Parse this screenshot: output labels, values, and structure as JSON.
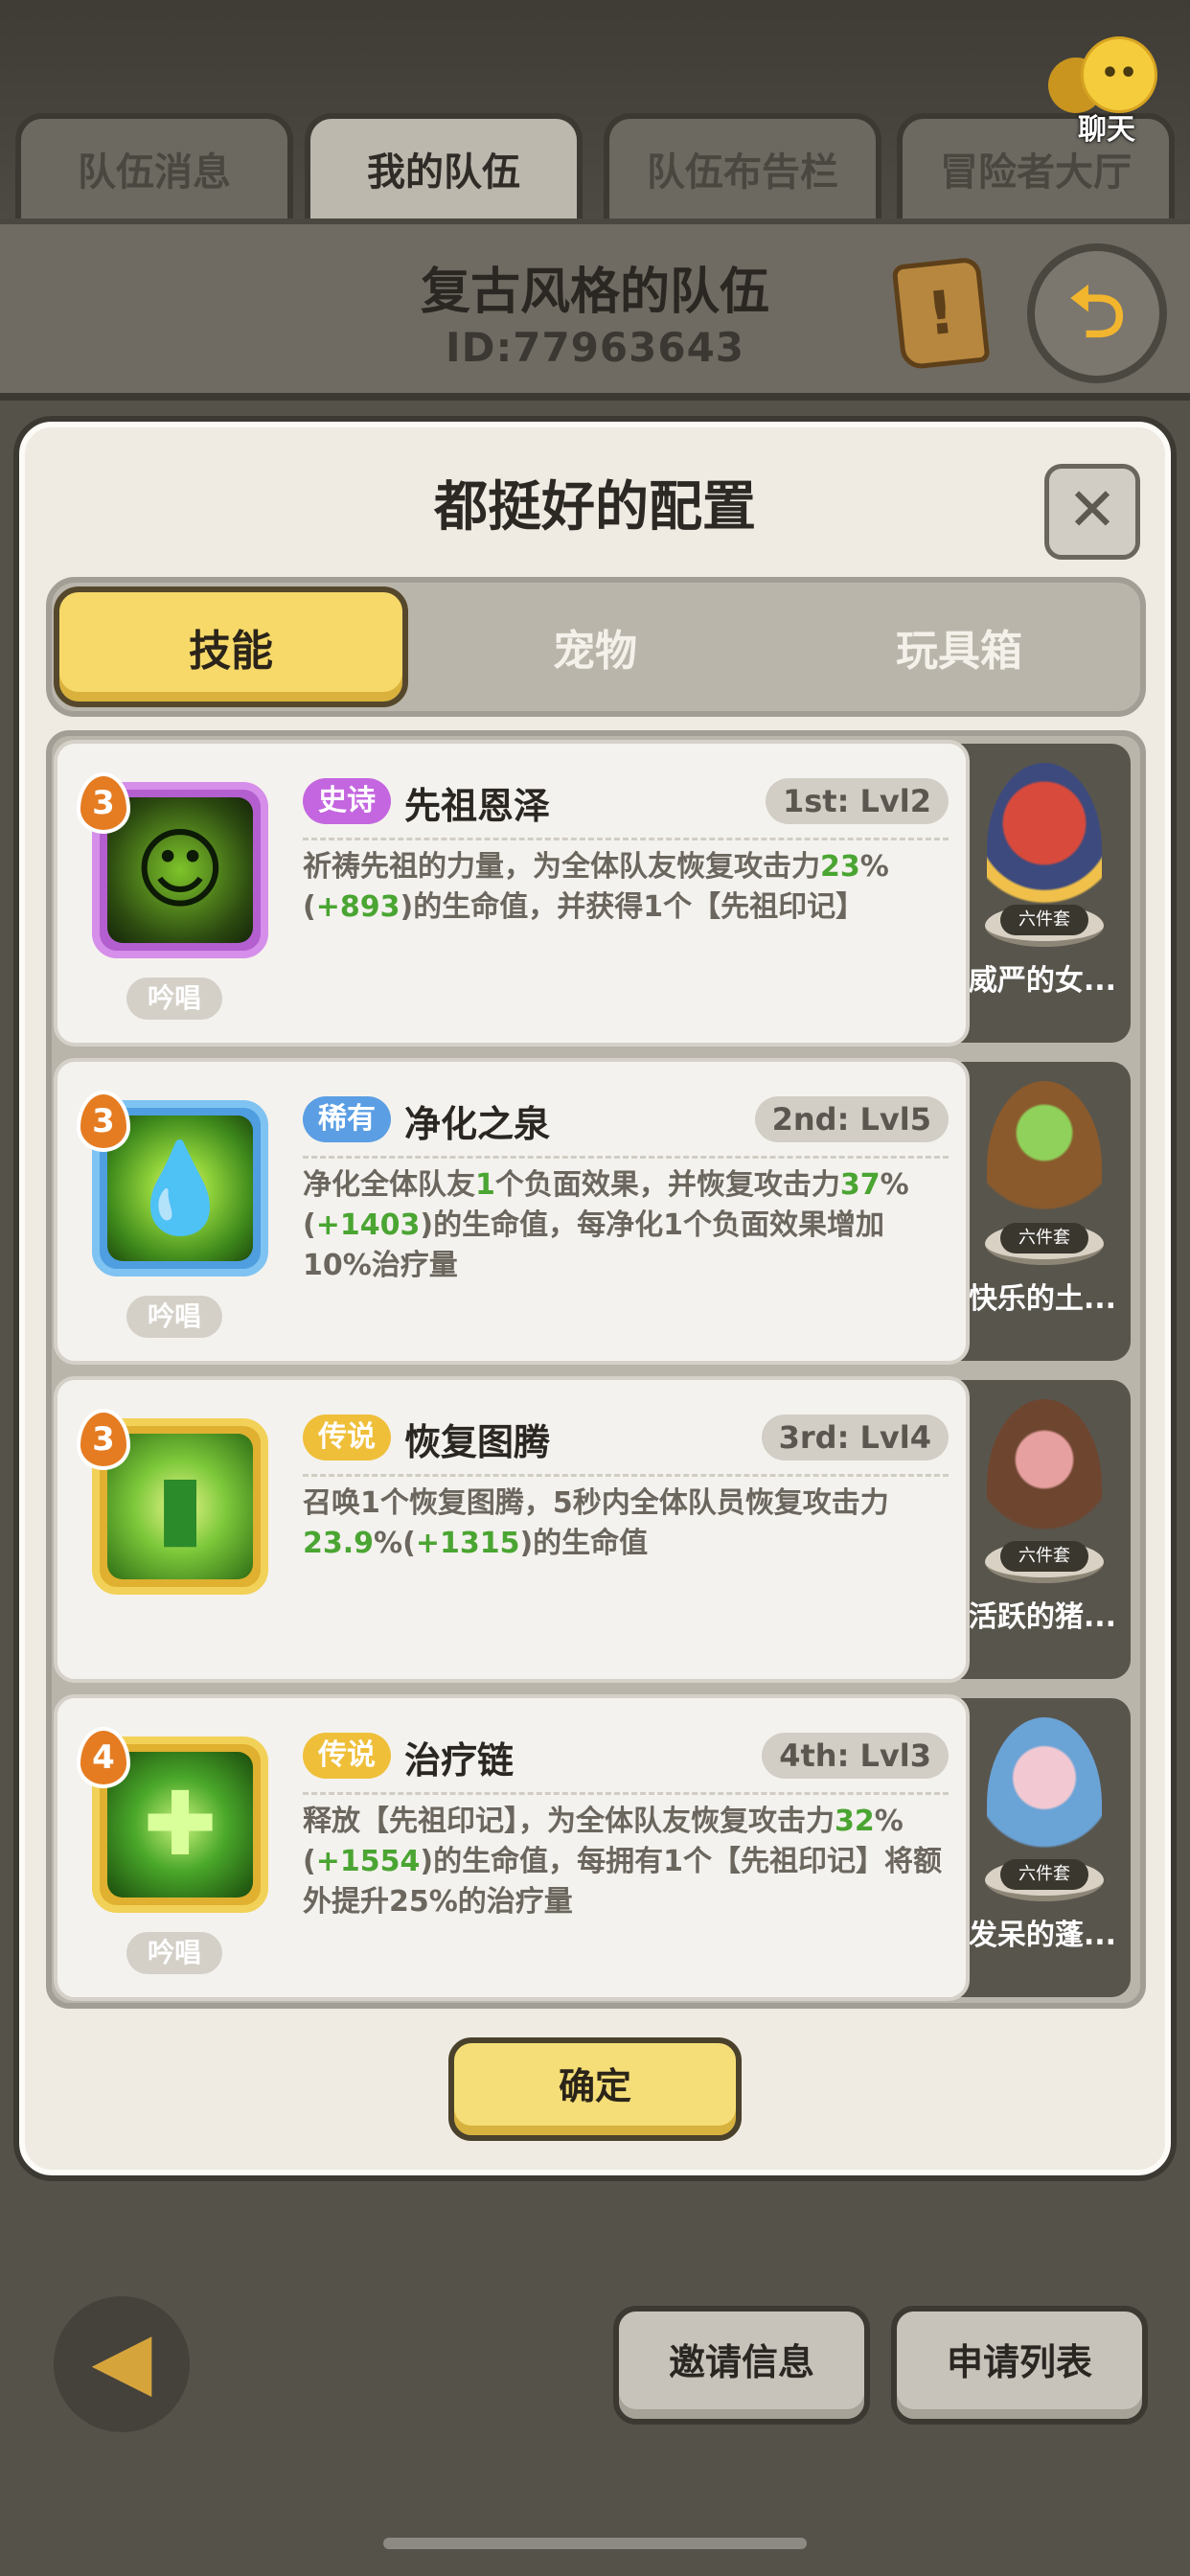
{
  "topbar": {
    "tabs": [
      {
        "label": "队伍消息"
      },
      {
        "label": "我的队伍"
      },
      {
        "label": "队伍布告栏"
      },
      {
        "label": "冒险者大厅"
      }
    ],
    "chat_label": "聊天"
  },
  "team": {
    "name": "复古风格的队伍",
    "id": "ID:77963643"
  },
  "dialog": {
    "title": "都挺好的配置",
    "segments": [
      {
        "label": "技能"
      },
      {
        "label": "宠物"
      },
      {
        "label": "玩具箱"
      }
    ],
    "skills": [
      {
        "level": "3",
        "rarity": "史诗",
        "rarity_color": "#c466e0",
        "name": "先祖恩泽",
        "slot": "1st: Lvl2",
        "desc_a": "祈祷先祖的力量，为全体队友恢复攻击力",
        "val1": "23",
        "desc_b": "%(",
        "val2": "+893",
        "desc_c": ")的生命值，并获得1个【先祖印记】",
        "desc_d": "",
        "val3": "",
        "desc_e": "",
        "tag": "吟唱",
        "icon": "spirit-dance-icon",
        "side_name": "威严的女...",
        "side_tag": "六件套"
      },
      {
        "level": "3",
        "rarity": "稀有",
        "rarity_color": "#5b9ee4",
        "name": "净化之泉",
        "slot": "2nd: Lvl5",
        "desc_a": "净化全体队友",
        "val1": "1",
        "desc_b": "个负面效果，并恢复攻击力",
        "val2": "37",
        "desc_c": "%(",
        "desc_d": "",
        "val3": "+1403",
        "desc_e": ")的生命值，每净化1个负面效果增加10%治疗量",
        "tag": "吟唱",
        "icon": "water-drop-icon",
        "side_name": "快乐的土...",
        "side_tag": "六件套"
      },
      {
        "level": "3",
        "rarity": "传说",
        "rarity_color": "#efbf3a",
        "name": "恢复图腾",
        "slot": "3rd: Lvl4",
        "desc_a": "召唤1个恢复图腾，5秒内全体队员恢复攻击力",
        "val1": "23.9",
        "desc_b": "%(",
        "val2": "+1315",
        "desc_c": ")的生命值",
        "desc_d": "",
        "val3": "",
        "desc_e": "",
        "tag": "",
        "icon": "totem-icon",
        "side_name": "活跃的猪...",
        "side_tag": "六件套"
      },
      {
        "level": "4",
        "rarity": "传说",
        "rarity_color": "#efbf3a",
        "name": "治疗链",
        "slot": "4th: Lvl3",
        "desc_a": "释放【先祖印记】，为全体队友恢复攻击力",
        "val1": "32",
        "desc_b": "%(",
        "val2": "+1554",
        "desc_c": ")的生命值，每拥有1个【先祖印记】将额外提升25%的治疗量",
        "desc_d": "",
        "val3": "",
        "desc_e": "",
        "tag": "吟唱",
        "icon": "heal-chain-icon",
        "side_name": "发呆的蓬...",
        "side_tag": "六件套"
      }
    ],
    "confirm_label": "确定"
  },
  "bottom": {
    "invite_label": "邀请信息",
    "apply_label": "申请列表"
  },
  "colors": {
    "accent_yellow": "#f6d969",
    "green_value": "#4aa532"
  }
}
